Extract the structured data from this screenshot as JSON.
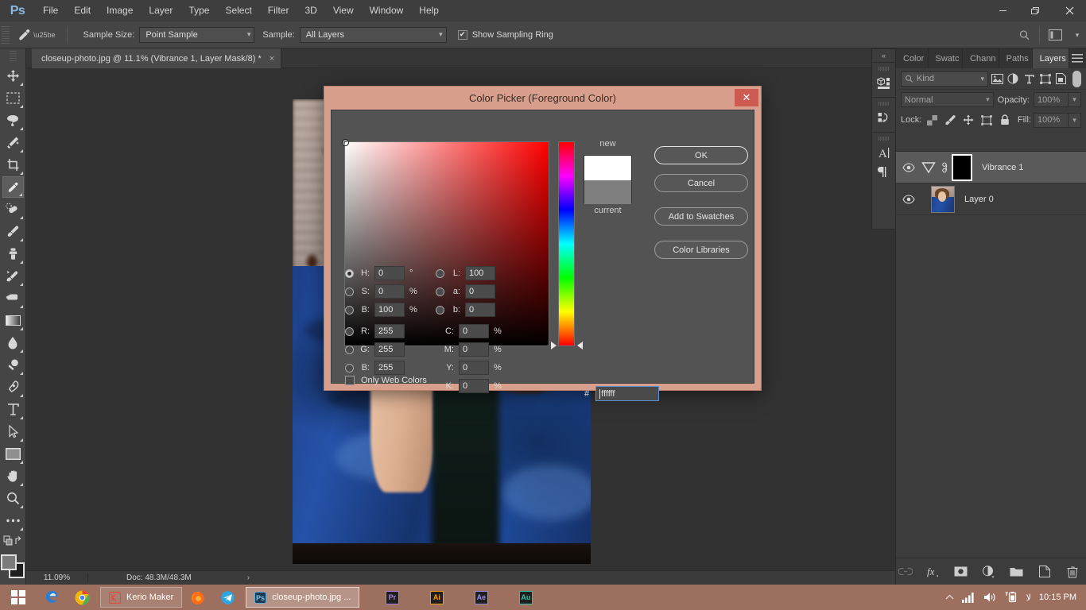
{
  "app": {
    "logo_text": "Ps",
    "menus": [
      "File",
      "Edit",
      "Image",
      "Layer",
      "Type",
      "Select",
      "Filter",
      "3D",
      "View",
      "Window",
      "Help"
    ],
    "window_controls": {
      "minimize": "—",
      "maximize": "❐",
      "close": "✕"
    }
  },
  "options_bar": {
    "sample_size_label": "Sample Size:",
    "sample_size_value": "Point Sample",
    "sample_label": "Sample:",
    "sample_value": "All Layers",
    "show_sampling_ring_label": "Show Sampling Ring",
    "show_sampling_ring_checked": true,
    "right_icons": [
      "search-icon",
      "workspace-icon",
      "chevron-down-icon"
    ]
  },
  "toolbar": {
    "tools": [
      {
        "name": "move-tool",
        "active": false
      },
      {
        "name": "marquee-tool",
        "active": false
      },
      {
        "name": "lasso-tool",
        "active": false
      },
      {
        "name": "magic-wand-tool",
        "active": false
      },
      {
        "name": "crop-tool",
        "active": false
      },
      {
        "name": "eyedropper-tool",
        "active": true
      },
      {
        "name": "healing-brush-tool",
        "active": false
      },
      {
        "name": "brush-tool",
        "active": false
      },
      {
        "name": "clone-stamp-tool",
        "active": false
      },
      {
        "name": "history-brush-tool",
        "active": false
      },
      {
        "name": "eraser-tool",
        "active": false
      },
      {
        "name": "gradient-tool",
        "active": false
      },
      {
        "name": "blur-tool",
        "active": false
      },
      {
        "name": "dodge-tool",
        "active": false
      },
      {
        "name": "pen-tool",
        "active": false
      },
      {
        "name": "type-tool",
        "active": false
      },
      {
        "name": "path-selection-tool",
        "active": false
      },
      {
        "name": "rectangle-tool",
        "active": false
      },
      {
        "name": "hand-tool",
        "active": false
      },
      {
        "name": "zoom-tool",
        "active": false
      },
      {
        "name": "more-tools",
        "active": false
      }
    ],
    "foreground_color": "#7b7b7b",
    "background_color": "#1e1e1e"
  },
  "document": {
    "tab_title": "closeup-photo.jpg @ 11.1% (Vibrance 1, Layer Mask/8) *",
    "close_glyph": "×"
  },
  "status_bar": {
    "zoom": "11.09%",
    "doc_info": "Doc: 48.3M/48.3M",
    "arrow": "›"
  },
  "secondary_dock": {
    "collapse_glyph": "«",
    "items": [
      "3d-panel-icon",
      "timeline-panel-icon",
      "character-panel-icon",
      "paragraph-panel-icon"
    ]
  },
  "layers_panel": {
    "tabs": [
      {
        "label": "Color",
        "active": false
      },
      {
        "label": "Swatc",
        "active": false
      },
      {
        "label": "Chann",
        "active": false
      },
      {
        "label": "Paths",
        "active": false
      },
      {
        "label": "Layers",
        "active": true
      }
    ],
    "menu_icon": "panel-menu-icon",
    "filter_kind_label": "Kind",
    "filter_icons": [
      "filter-pixel-icon",
      "filter-adjustment-icon",
      "filter-type-icon",
      "filter-shape-icon",
      "filter-smart-object-icon"
    ],
    "blend_mode": "Normal",
    "opacity_label": "Opacity:",
    "opacity_value": "100%",
    "lock_label": "Lock:",
    "lock_icons": [
      "lock-transparent-icon",
      "lock-image-icon",
      "lock-position-icon",
      "lock-artboard-icon",
      "lock-all-icon"
    ],
    "fill_label": "Fill:",
    "fill_value": "100%",
    "layers": [
      {
        "name": "Vibrance 1",
        "visible": true,
        "selected": true,
        "type": "adjustment",
        "has_mask": true
      },
      {
        "name": "Layer 0",
        "visible": true,
        "selected": false,
        "type": "image",
        "has_mask": false
      }
    ],
    "footer_icons": [
      "link-layers-icon",
      "layer-style-fx-icon",
      "add-layer-mask-icon",
      "new-adjustment-layer-icon",
      "new-group-icon",
      "new-layer-icon",
      "delete-layer-icon"
    ]
  },
  "color_picker": {
    "title": "Color Picker (Foreground Color)",
    "close_glyph": "✕",
    "titlebar_color": "#d8a08c",
    "new_label": "new",
    "current_label": "current",
    "new_color": "#ffffff",
    "current_color": "#7f7f7f",
    "buttons": [
      {
        "label": "OK",
        "primary": true
      },
      {
        "label": "Cancel",
        "primary": false
      },
      {
        "label": "Add to Swatches",
        "primary": false
      },
      {
        "label": "Color Libraries",
        "primary": false
      }
    ],
    "hsb": [
      {
        "key": "H:",
        "value": "0",
        "unit": "°",
        "selected": true
      },
      {
        "key": "S:",
        "value": "0",
        "unit": "%",
        "selected": false
      },
      {
        "key": "B:",
        "value": "100",
        "unit": "%",
        "selected": false
      }
    ],
    "lab": [
      {
        "key": "L:",
        "value": "100",
        "unit": "",
        "selected": false
      },
      {
        "key": "a:",
        "value": "0",
        "unit": "",
        "selected": false
      },
      {
        "key": "b:",
        "value": "0",
        "unit": "",
        "selected": false
      }
    ],
    "rgb": [
      {
        "key": "R:",
        "value": "255",
        "unit": "",
        "selected": false
      },
      {
        "key": "G:",
        "value": "255",
        "unit": "",
        "selected": false
      },
      {
        "key": "B:",
        "value": "255",
        "unit": "",
        "selected": false
      }
    ],
    "cmyk": [
      {
        "key": "C:",
        "value": "0",
        "unit": "%"
      },
      {
        "key": "M:",
        "value": "0",
        "unit": "%"
      },
      {
        "key": "Y:",
        "value": "0",
        "unit": "%"
      },
      {
        "key": "K:",
        "value": "0",
        "unit": "%"
      }
    ],
    "only_web_colors_label": "Only Web Colors",
    "only_web_colors_checked": false,
    "hex_symbol": "#",
    "hex_value": "ffffff"
  },
  "taskbar": {
    "start_icon": "windows-start-icon",
    "pinned": [
      "edge-browser-icon",
      "chrome-browser-icon"
    ],
    "apps": [
      {
        "label": "Kerio Maker",
        "icon": "kerio-icon",
        "active": false
      },
      {
        "label": "closeup-photo.jpg ...",
        "icon": "photoshop-icon",
        "active": true
      }
    ],
    "quick_icons": [
      "firefox-icon",
      "telegram-icon"
    ],
    "adobe_apps": [
      {
        "label": "Pr",
        "color": "#b07be8"
      },
      {
        "label": "Ai",
        "color": "#ff9a00"
      },
      {
        "label": "Ae",
        "color": "#9b8cf5"
      },
      {
        "label": "Au",
        "color": "#27c6a4"
      }
    ],
    "tray_icons": [
      "show-hidden-icons-icon",
      "network-signal-icon",
      "volume-icon",
      "battery-icon",
      "language-icon"
    ],
    "clock": "10:15 PM",
    "accent_color": "#9d6f5e"
  }
}
